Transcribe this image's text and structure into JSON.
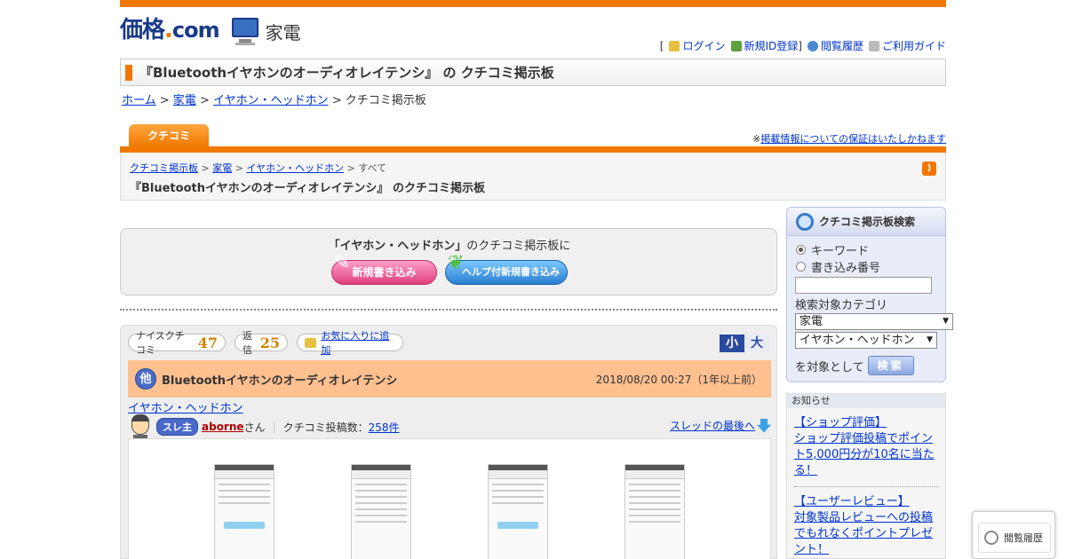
{
  "logo": {
    "kakaku_main": "価格",
    "kakaku_dot": ".",
    "kakaku_com": "com",
    "category": "家電"
  },
  "toplinks": {
    "bracket_open": "[",
    "login": "ログイン",
    "register": "新規ID登録",
    "bracket_close": "]",
    "history": "閲覧履歴",
    "guide": "ご利用ガイド"
  },
  "page_title": "『Bluetoothイヤホンのオーディオレイテンシ』 の クチコミ掲示板",
  "breadcrumb": {
    "home": "ホーム",
    "sep": " > ",
    "kaden": "家電",
    "category": "イヤホン・ヘッドホン",
    "current": "クチコミ掲示板"
  },
  "tab": {
    "label": "クチコミ"
  },
  "notice": {
    "prefix": "※",
    "link": "掲載情報についての保証はいたしかねます"
  },
  "subhead": {
    "crumb1": "クチコミ掲示板",
    "crumb2": "家電",
    "crumb3": "イヤホン・ヘッドホン",
    "crumb4": "すべて",
    "sep": " > ",
    "title": "『Bluetoothイヤホンのオーディオレイテンシ』 のクチコミ掲示板"
  },
  "postbox": {
    "lead_category": "「イヤホン・ヘッドホン」",
    "lead_suffix": "のクチコミ掲示板に",
    "new_post": "新規書き込み",
    "help_post": "ヘルプ付新規書き込み"
  },
  "thread": {
    "nice_label": "ナイスクチコミ",
    "nice_count": "47",
    "reply_label": "返信",
    "reply_count": "25",
    "favorite": "お気に入りに追加",
    "size_small": "小",
    "size_large": "大",
    "other_badge": "他",
    "title": "Bluetoothイヤホンのオーディオレイテンシ",
    "date": "2018/08/20 00:27（1年以上前）",
    "category_link": "イヤホン・ヘッドホン",
    "author_badge": "スレ主",
    "author": "aborne",
    "author_suffix": "さん",
    "post_count_label": "クチコミ投稿数：",
    "post_count": "258件",
    "last_link": "スレッドの最後へ"
  },
  "search": {
    "title": "クチコミ掲示板検索",
    "radio_keyword": "キーワード",
    "radio_number": "書き込み番号",
    "category_label": "検索対象カテゴリ",
    "select1": "家電",
    "select2": "イヤホン・ヘッドホン",
    "target_label": "を対象として",
    "button": "検索"
  },
  "news": {
    "header": "お知らせ",
    "item1_title": "【ショップ評価】",
    "item1_body": "ショップ評価投稿でポイント5,000円分が10名に当たる！",
    "item2_title": "【ユーザーレビュー】",
    "item2_body": "対象製品レビューへの投稿でもれなくポイントプレゼント！"
  },
  "history_float": {
    "label": "閲覧履歴"
  },
  "colors": {
    "accent": "#f07800",
    "link": "#0033cc",
    "thread_header": "#ffc090"
  }
}
